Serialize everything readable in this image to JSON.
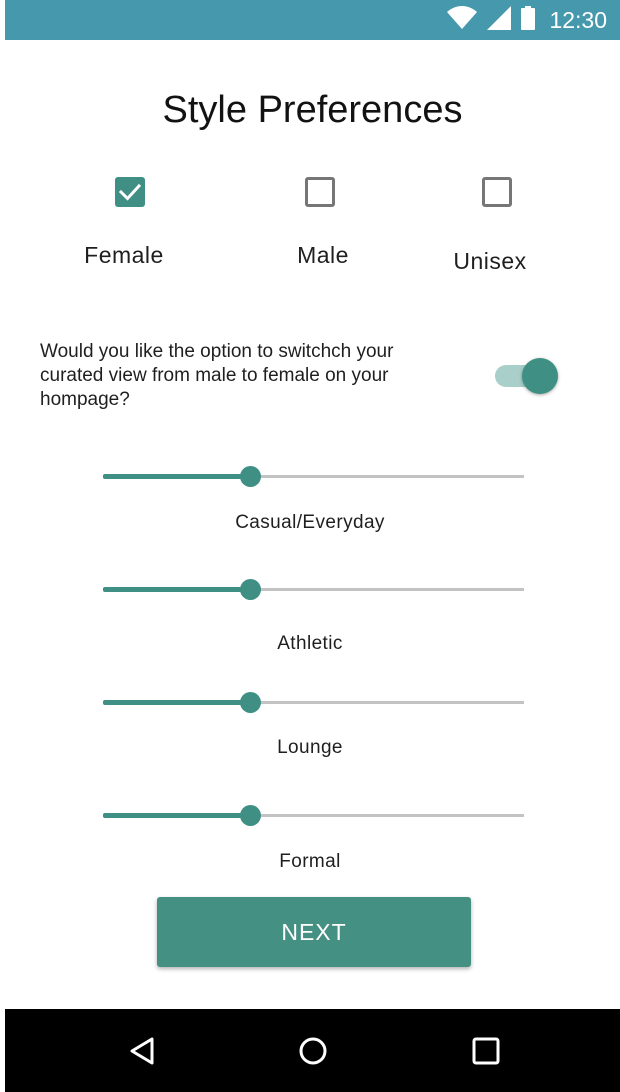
{
  "status_bar": {
    "time": "12:30",
    "background": "#4699ad",
    "icons": [
      "wifi-icon",
      "signal-icon",
      "battery-icon"
    ]
  },
  "title": "Style Preferences",
  "gender_options": [
    {
      "label": "Female",
      "checked": true
    },
    {
      "label": "Male",
      "checked": false
    },
    {
      "label": "Unisex",
      "checked": false
    }
  ],
  "switch_question": {
    "text": "Would you like the option to switchch your curated view from male to female on your hompage?",
    "enabled": true
  },
  "sliders": [
    {
      "label": "Casual/Everyday",
      "value": 0.35
    },
    {
      "label": "Athletic",
      "value": 0.35
    },
    {
      "label": "Lounge",
      "value": 0.35
    },
    {
      "label": "Formal",
      "value": 0.35
    }
  ],
  "next_button": {
    "label": "NEXT"
  },
  "colors": {
    "accent": "#3f8f84",
    "status_bar": "#4699ad",
    "track": "#c3c3c3"
  },
  "nav_bar": {
    "icons": [
      "back-icon",
      "home-icon",
      "recents-icon"
    ]
  }
}
